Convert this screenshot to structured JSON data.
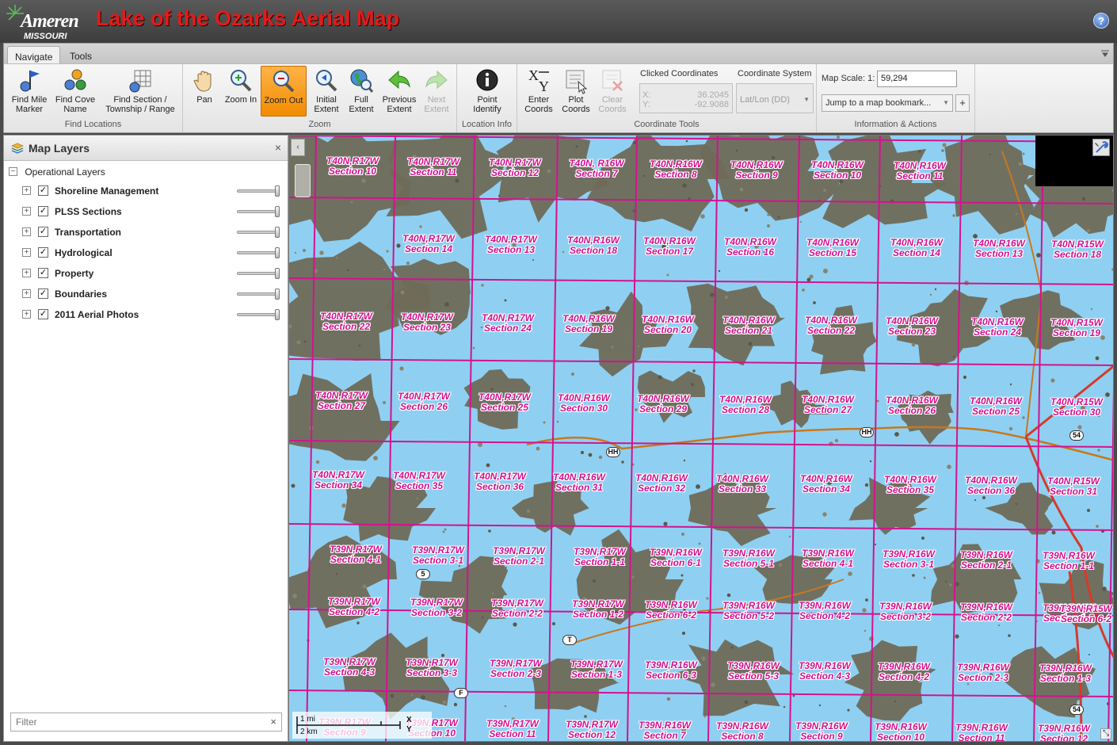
{
  "header": {
    "brand": "Ameren",
    "brand_sub": "MISSOURI",
    "title": "Lake of the Ozarks Aerial Map",
    "help": "?"
  },
  "tabs": [
    {
      "label": "Navigate",
      "active": true
    },
    {
      "label": "Tools",
      "active": false
    }
  ],
  "ribbon": {
    "groups": [
      {
        "label": "Find Locations",
        "buttons": [
          {
            "label": "Find Mile\nMarker",
            "icon": "flag-pin-icon"
          },
          {
            "label": "Find Cove\nName",
            "icon": "pins-icon"
          },
          {
            "label": "Find Section /\nTownship / Range",
            "icon": "grid-pin-icon"
          }
        ]
      },
      {
        "label": "Zoom",
        "buttons": [
          {
            "label": "Pan",
            "icon": "hand-icon"
          },
          {
            "label": "Zoom In",
            "icon": "zoom-in-icon"
          },
          {
            "label": "Zoom Out",
            "icon": "zoom-out-icon",
            "active": true
          },
          {
            "label": "Initial\nExtent",
            "icon": "initial-extent-icon"
          },
          {
            "label": "Full\nExtent",
            "icon": "globe-icon"
          },
          {
            "label": "Previous\nExtent",
            "icon": "arrow-left-icon"
          },
          {
            "label": "Next\nExtent",
            "icon": "arrow-right-icon",
            "disabled": true
          }
        ]
      },
      {
        "label": "Location Info",
        "buttons": [
          {
            "label": "Point\nIdentify",
            "icon": "info-icon"
          }
        ]
      },
      {
        "label": "Coordinate Tools",
        "buttons": [
          {
            "label": "Enter\nCoords",
            "icon": "xy-icon"
          },
          {
            "label": "Plot\nCoords",
            "icon": "plot-icon"
          },
          {
            "label": "Clear\nCoords",
            "icon": "clear-icon",
            "disabled": true
          }
        ],
        "clicked_label": "Clicked Coordinates",
        "x_label": "X:",
        "y_label": "Y:",
        "x_value": "36.2045",
        "y_value": "-92.9088",
        "system_label": "Coordinate System",
        "system_value": "Lat/Lon (DD)"
      },
      {
        "label": "Information & Actions",
        "scale_label": "Map Scale: 1:",
        "scale_value": "59,294",
        "bookmark_placeholder": "Jump to a map bookmark...",
        "add": "+"
      }
    ]
  },
  "panel": {
    "title": "Map Layers",
    "close": "×",
    "root": "Operational Layers",
    "layers": [
      {
        "name": "Shoreline Management",
        "opacity": 1.0
      },
      {
        "name": "PLSS Sections",
        "opacity": 1.0
      },
      {
        "name": "Transportation",
        "opacity": 1.0
      },
      {
        "name": "Hydrological",
        "opacity": 1.0
      },
      {
        "name": "Property",
        "opacity": 1.0
      },
      {
        "name": "Boundaries",
        "opacity": 1.0
      },
      {
        "name": "2011 Aerial Photos",
        "opacity": 1.0
      }
    ],
    "filter_placeholder": "Filter",
    "filter_clear": "×"
  },
  "map": {
    "collapse": "‹",
    "scalebar_mi": "1 mi",
    "scalebar_km": "2 km",
    "xy_x": "X",
    "xy_y": "Y",
    "roads": [
      "HH",
      "HH",
      "5",
      "T",
      "F",
      "54",
      "54"
    ],
    "sections": [
      [
        "T40N,R17W",
        "Section 10"
      ],
      [
        "T40N,R17W",
        "Section 11"
      ],
      [
        "T40N,R17W",
        "Section 12"
      ],
      [
        "T40N, R16W",
        "Section 7"
      ],
      [
        "T40N,R16W",
        "Section 8"
      ],
      [
        "T40N,R16W",
        "Section 9"
      ],
      [
        "T40N,R16W",
        "Section 10"
      ],
      [
        "T40N,R16W",
        "Section 11"
      ],
      [
        "T40N,R17W",
        "Section 14"
      ],
      [
        "T40N,R17W",
        "Section 13"
      ],
      [
        "T40N,R16W",
        "Section 18"
      ],
      [
        "T40N,R16W",
        "Section 17"
      ],
      [
        "T40N,R16W",
        "Section 16"
      ],
      [
        "T40N,R16W",
        "Section 15"
      ],
      [
        "T40N,R16W",
        "Section 14"
      ],
      [
        "T40N,R16W",
        "Section 13"
      ],
      [
        "T40N,R15W",
        "Section 18"
      ],
      [
        "T40N,R17W",
        "Section 22"
      ],
      [
        "T40N,R17W",
        "Section 23"
      ],
      [
        "T40N,R17W",
        "Section 24"
      ],
      [
        "T40N,R16W",
        "Section 19"
      ],
      [
        "T40N,R16W",
        "Section 20"
      ],
      [
        "T40N,R16W",
        "Section 21"
      ],
      [
        "T40N,R16W",
        "Section 22"
      ],
      [
        "T40N,R16W",
        "Section 23"
      ],
      [
        "T40N,R16W",
        "Section 24"
      ],
      [
        "T40N,R15W",
        "Section 19"
      ],
      [
        "T40N,R17W",
        "Section 27"
      ],
      [
        "T40N,R17W",
        "Section 26"
      ],
      [
        "T40N,R17W",
        "Section 25"
      ],
      [
        "T40N,R16W",
        "Section 30"
      ],
      [
        "T40N,R16W",
        "Section 29"
      ],
      [
        "T40N,R16W",
        "Section 28"
      ],
      [
        "T40N,R16W",
        "Section 27"
      ],
      [
        "T40N,R16W",
        "Section 26"
      ],
      [
        "T40N,R16W",
        "Section 25"
      ],
      [
        "T40N,R15W",
        "Section 30"
      ],
      [
        "T40N,R17W",
        "Section 34"
      ],
      [
        "T40N,R17W",
        "Section 35"
      ],
      [
        "T40N,R17W",
        "Section 36"
      ],
      [
        "T40N,R16W",
        "Section 31"
      ],
      [
        "T40N,R16W",
        "Section 32"
      ],
      [
        "T40N,R16W",
        "Section 33"
      ],
      [
        "T40N,R16W",
        "Section 34"
      ],
      [
        "T40N,R16W",
        "Section 35"
      ],
      [
        "T40N,R16W",
        "Section 36"
      ],
      [
        "T40N,R15W",
        "Section 31"
      ],
      [
        "T39N,R17W",
        "Section 4-1"
      ],
      [
        "T39N,R17W",
        "Section 3-1"
      ],
      [
        "T39N,R17W",
        "Section 2-1"
      ],
      [
        "T39N,R17W",
        "Section 1-1"
      ],
      [
        "T39N,R16W",
        "Section 6-1"
      ],
      [
        "T39N,R16W",
        "Section 5-1"
      ],
      [
        "T39N,R16W",
        "Section 4-1"
      ],
      [
        "T39N,R16W",
        "Section 3-1"
      ],
      [
        "T39N,R16W",
        "Section 2-1"
      ],
      [
        "T39N,R16W",
        "Section 1-1"
      ],
      [
        "T39N,R17W",
        "Section 4-2"
      ],
      [
        "T39N,R17W",
        "Section 3-2"
      ],
      [
        "T39N,R17W",
        "Section 2-2"
      ],
      [
        "T39N,R17W",
        "Section 1-2"
      ],
      [
        "T39N,R16W",
        "Section 6-2"
      ],
      [
        "T39N,R16W",
        "Section 5-2"
      ],
      [
        "T39N,R16W",
        "Section 4-2"
      ],
      [
        "T39N,R16W",
        "Section 3-2"
      ],
      [
        "T39N,R16W",
        "Section 2-2"
      ],
      [
        "T39N,R16W",
        "Section 1-2"
      ],
      [
        "T39N,R15W",
        "Section 6-2"
      ],
      [
        "T39N,R17W",
        "Section 4-3"
      ],
      [
        "T39N,R17W",
        "Section 3-3"
      ],
      [
        "T39N,R17W",
        "Section 2-3"
      ],
      [
        "T39N,R17W",
        "Section 1-3"
      ],
      [
        "T39N,R16W",
        "Section 6-3"
      ],
      [
        "T39N,R16W",
        "Section 5-3"
      ],
      [
        "T39N,R16W",
        "Section 4-3"
      ],
      [
        "T39N,R16W",
        "Section 4-2"
      ],
      [
        "T39N,R16W",
        "Section 2-3"
      ],
      [
        "T39N,R16W",
        "Section 1-3"
      ],
      [
        "T39N,R17W",
        "Section 9"
      ],
      [
        "T39N,R17W",
        "Section 10"
      ],
      [
        "T39N,R17W",
        "Section 11"
      ],
      [
        "T39N,R17W",
        "Section 12"
      ],
      [
        "T39N,R16W",
        "Section 7"
      ],
      [
        "T39N,R16W",
        "Section 8"
      ],
      [
        "T39N,R16W",
        "Section 9"
      ],
      [
        "T39N,R16W",
        "Section 10"
      ],
      [
        "T39N,R16W",
        "Section 11"
      ],
      [
        "T39N,R16W",
        "Section 12"
      ]
    ]
  },
  "colors": {
    "section_line": "#d4128f",
    "water": "#8fd0f2",
    "land": "#6f6a58",
    "road": "#c8781e",
    "highway": "#d63a2a",
    "title": "#e31b1b",
    "active_tool": "#f28c00"
  }
}
